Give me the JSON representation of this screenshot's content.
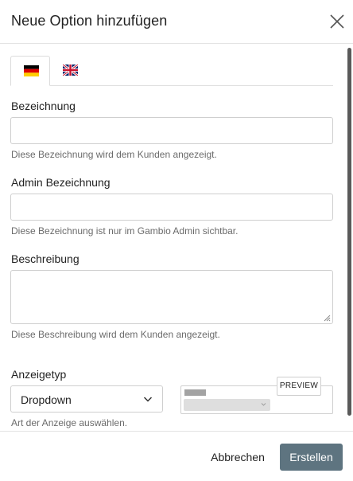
{
  "dialog": {
    "title": "Neue Option hinzufügen",
    "close_icon": "close-icon"
  },
  "tabs": [
    {
      "language": "de",
      "icon": "flag-germany-icon",
      "active": true
    },
    {
      "language": "en",
      "icon": "flag-united-kingdom-icon",
      "active": false
    }
  ],
  "fields": {
    "name": {
      "label": "Bezeichnung",
      "value": "",
      "help": "Diese Bezeichnung wird dem Kunden angezeigt."
    },
    "admin_name": {
      "label": "Admin Bezeichnung",
      "value": "",
      "help": "Diese Bezeichnung ist nur im Gambio Admin sichtbar."
    },
    "description": {
      "label": "Beschreibung",
      "value": "",
      "help": "Diese Beschreibung wird dem Kunden angezeigt."
    },
    "display_type": {
      "label": "Anzeigetyp",
      "selected": "Dropdown",
      "help": "Art der Anzeige auswählen."
    }
  },
  "preview": {
    "badge": "PREVIEW"
  },
  "footer": {
    "cancel_label": "Abbrechen",
    "create_label": "Erstellen"
  },
  "colors": {
    "primary_button": "#5e7480",
    "border": "#cfcfcf",
    "help_text": "#6b6b6b"
  }
}
